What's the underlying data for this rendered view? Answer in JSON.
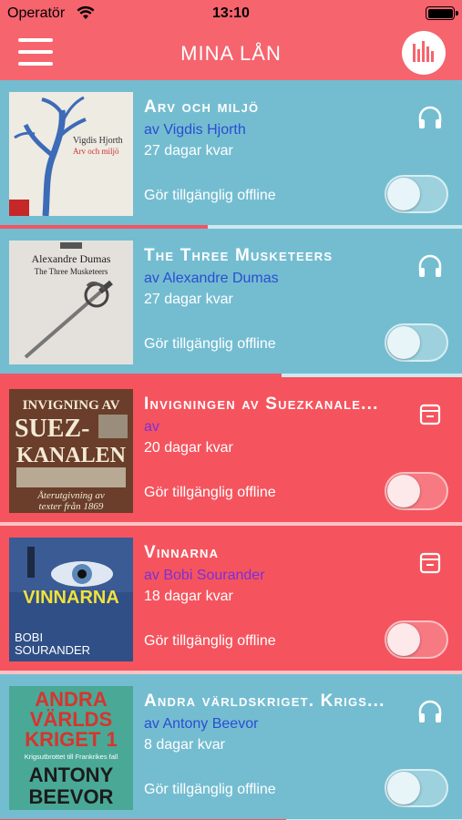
{
  "status_bar": {
    "carrier": "Operatör",
    "time": "13:10"
  },
  "nav": {
    "title": "MINA LÅN"
  },
  "colors": {
    "header": "#f6646e",
    "row_audio": "#74bdd1",
    "row_ebook": "#f5545e",
    "author_audio": "#2b4dd1",
    "author_ebook": "#7b2fd6"
  },
  "loans": [
    {
      "title": "Arv och miljö",
      "author": "av Vigdis Hjorth",
      "days_left": "27 dagar kvar",
      "offline_label": "Gör tillgänglig offline",
      "type_icon": "headphones-icon",
      "offline_enabled": false,
      "progress": 0.45,
      "cover": {
        "author": "Vigdis Hjorth",
        "title": "Arv och miljö"
      }
    },
    {
      "title": "The Three Musketeers",
      "author": "av Alexandre Dumas",
      "days_left": "27 dagar kvar",
      "offline_label": "Gör tillgänglig offline",
      "type_icon": "headphones-icon",
      "offline_enabled": false,
      "progress": 0.61,
      "cover": {
        "author": "Alexandre Dumas",
        "title": "The Three Musketeers"
      }
    },
    {
      "title": "Invigningen av Suezkanale...",
      "author": "av",
      "days_left": "20 dagar kvar",
      "offline_label": "Gör tillgänglig offline",
      "type_icon": "book-icon",
      "offline_enabled": false,
      "progress": 0,
      "cover": {
        "line1": "INVIGNING AV",
        "line2": "SUEZ-",
        "line3": "KANALEN",
        "sub1": "Återutgivning av",
        "sub2": "texter från 1869"
      }
    },
    {
      "title": "Vinnarna",
      "author": "av Bobi Sourander",
      "days_left": "18 dagar kvar",
      "offline_label": "Gör tillgänglig offline",
      "type_icon": "book-icon",
      "offline_enabled": false,
      "progress": 0,
      "cover": {
        "title": "VINNARNA",
        "author1": "BOBI",
        "author2": "SOURANDER"
      }
    },
    {
      "title": "Andra världskriget. Krigs...",
      "author": "av Antony Beevor",
      "days_left": "8 dagar kvar",
      "offline_label": "Gör tillgänglig offline",
      "type_icon": "headphones-icon",
      "offline_enabled": false,
      "progress": 0.62,
      "cover": {
        "line1": "ANDRA",
        "line2": "VÄRLDS",
        "line3": "KRIGET 1",
        "sub": "Krigsutbrottet till Frankrikes fall",
        "author1": "ANTONY",
        "author2": "BEEVOR"
      }
    }
  ]
}
